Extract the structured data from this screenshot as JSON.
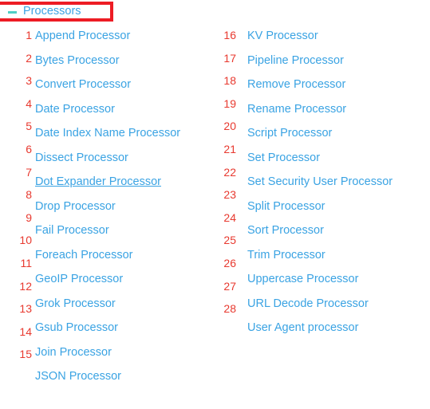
{
  "section": {
    "title": "Processors",
    "toggle_icon": "minus-icon",
    "expanded": true,
    "highlight_color": "#ed1c24",
    "toggle_icon_color": "#4fcfc4",
    "title_color": "#3aa3e3"
  },
  "colors": {
    "link": "#3aa3e3",
    "number": "#e8392f",
    "annotation": "#ed1c24",
    "background": "#ffffff"
  },
  "list": {
    "left_column": [
      {
        "number": "1",
        "label": "Append Processor",
        "hovered": false
      },
      {
        "number": "2",
        "label": "Bytes Processor",
        "hovered": false
      },
      {
        "number": "3",
        "label": "Convert Processor",
        "hovered": false
      },
      {
        "number": "4",
        "label": "Date Processor",
        "hovered": false
      },
      {
        "number": "5",
        "label": "Date Index Name Processor",
        "hovered": false
      },
      {
        "number": "6",
        "label": "Dissect Processor",
        "hovered": false
      },
      {
        "number": "7",
        "label": "Dot Expander Processor",
        "hovered": true
      },
      {
        "number": "8",
        "label": "Drop Processor",
        "hovered": false
      },
      {
        "number": "9",
        "label": "Fail Processor",
        "hovered": false
      },
      {
        "number": "10",
        "label": "Foreach Processor",
        "hovered": false
      },
      {
        "number": "11",
        "label": "GeoIP Processor",
        "hovered": false
      },
      {
        "number": "12",
        "label": "Grok Processor",
        "hovered": false
      },
      {
        "number": "13",
        "label": "Gsub Processor",
        "hovered": false
      },
      {
        "number": "14",
        "label": "Join Processor",
        "hovered": false
      },
      {
        "number": "15",
        "label": "JSON Processor",
        "hovered": false
      }
    ],
    "right_column": [
      {
        "number": "16",
        "label": "KV Processor",
        "hovered": false
      },
      {
        "number": "17",
        "label": "Pipeline Processor",
        "hovered": false
      },
      {
        "number": "18",
        "label": "Remove Processor",
        "hovered": false
      },
      {
        "number": "19",
        "label": "Rename Processor",
        "hovered": false
      },
      {
        "number": "20",
        "label": "Script Processor",
        "hovered": false
      },
      {
        "number": "21",
        "label": "Set Processor",
        "hovered": false
      },
      {
        "number": "22",
        "label": "Set Security User Processor",
        "hovered": false
      },
      {
        "number": "23",
        "label": "Split Processor",
        "hovered": false
      },
      {
        "number": "24",
        "label": "Sort Processor",
        "hovered": false
      },
      {
        "number": "25",
        "label": "Trim Processor",
        "hovered": false
      },
      {
        "number": "26",
        "label": "Uppercase Processor",
        "hovered": false
      },
      {
        "number": "27",
        "label": "URL Decode Processor",
        "hovered": false
      },
      {
        "number": "28",
        "label": "User Agent processor",
        "hovered": false
      }
    ]
  }
}
